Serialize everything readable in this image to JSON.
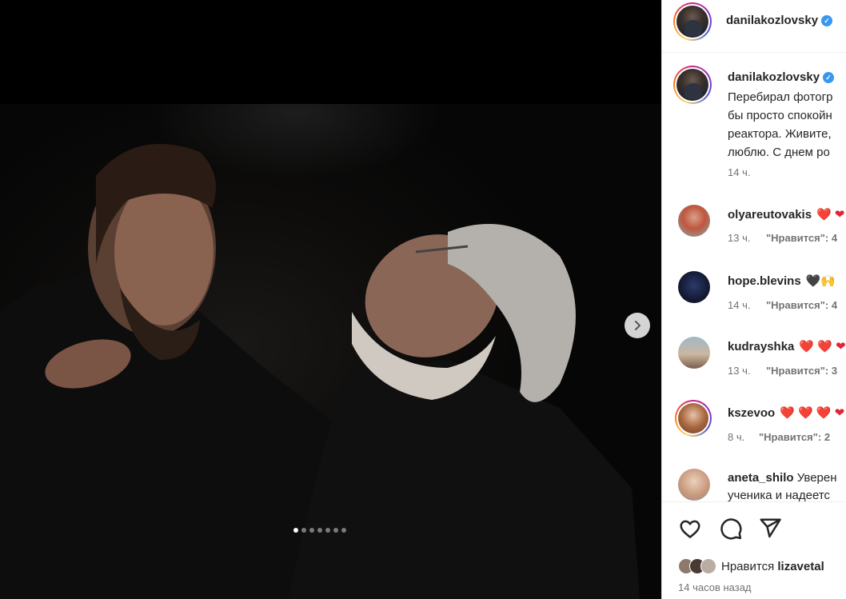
{
  "post": {
    "username": "danilakozlovsky",
    "caption": "Перебирал фотогр\nбы просто спокойн\nреактора. Живите,\nлюблю. С днем ро",
    "caption_time": "14 ч."
  },
  "comments": [
    {
      "user": "olyareutovakis",
      "text": "",
      "emoji": "❤️ ❤",
      "time": "13 ч.",
      "likes": "\"Нравится\": 4"
    },
    {
      "user": "hope.blevins",
      "text": "",
      "emoji": "🖤🙌",
      "time": "14 ч.",
      "likes": "\"Нравится\": 4"
    },
    {
      "user": "kudrayshka",
      "text": "",
      "emoji": "❤️ ❤️ ❤",
      "time": "13 ч.",
      "likes": "\"Нравится\": 3"
    },
    {
      "user": "kszevoo",
      "text": "",
      "emoji": "❤️ ❤️ ❤️ ❤",
      "time": "8 ч.",
      "likes": "\"Нравится\": 2"
    },
    {
      "user": "aneta_shilo",
      "text": "Уверен",
      "line2": "ученика и надеетс",
      "emoji": "",
      "time": "",
      "likes": ""
    }
  ],
  "actions": {
    "like_icon": "heart-icon",
    "comment_icon": "comment-icon",
    "share_icon": "share-icon"
  },
  "likes": {
    "prefix": "Нравится",
    "user": "lizavetal"
  },
  "post_date": "14 часов назад",
  "carousel": {
    "total": 7,
    "active_index": 0
  },
  "colors": {
    "verified": "#3897f0",
    "heart": "#e0243a",
    "text": "#262626",
    "muted": "#737373"
  }
}
